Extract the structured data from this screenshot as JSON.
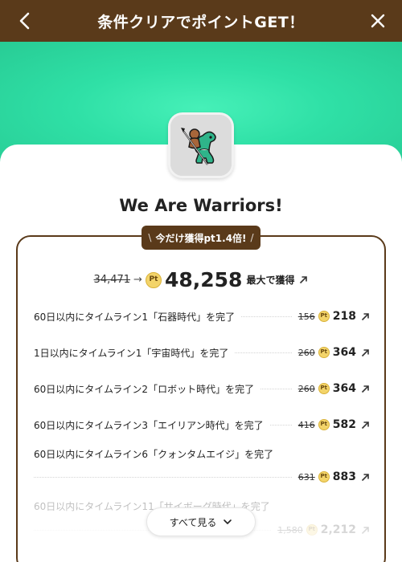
{
  "header": {
    "title": "条件クリアでポイントGET！"
  },
  "game": {
    "title": "We Are Warriors!"
  },
  "badge": {
    "left_deco": "\\",
    "text": "今だけ獲得pt1.4倍!",
    "right_deco": "/"
  },
  "summary": {
    "old_points": "34,471",
    "arrow": "→",
    "coin_label": "Pt",
    "new_points": "48,258",
    "suffix": "最大で獲得"
  },
  "tasks": [
    {
      "name": "60日以内にタイムライン1「石器時代」を完了",
      "old": "156",
      "new": "218"
    },
    {
      "name": "1日以内にタイムライン1「宇宙時代」を完了",
      "old": "260",
      "new": "364"
    },
    {
      "name": "60日以内にタイムライン2「ロボット時代」を完了",
      "old": "260",
      "new": "364"
    },
    {
      "name": "60日以内にタイムライン3「エイリアン時代」を完了",
      "old": "416",
      "new": "582"
    },
    {
      "name": "60日以内にタイムライン6「クォンタムエイジ」を完了",
      "old": "631",
      "new": "883"
    },
    {
      "name": "60日以内にタイムライン11「サイボーグ時代」を完了",
      "old": "1,580",
      "new": "2,212"
    }
  ],
  "see_all": {
    "label": "すべて見る"
  },
  "colors": {
    "brown": "#5a3a1a",
    "hero_green": "#2fe0a6",
    "coin": "#f3d46a"
  }
}
